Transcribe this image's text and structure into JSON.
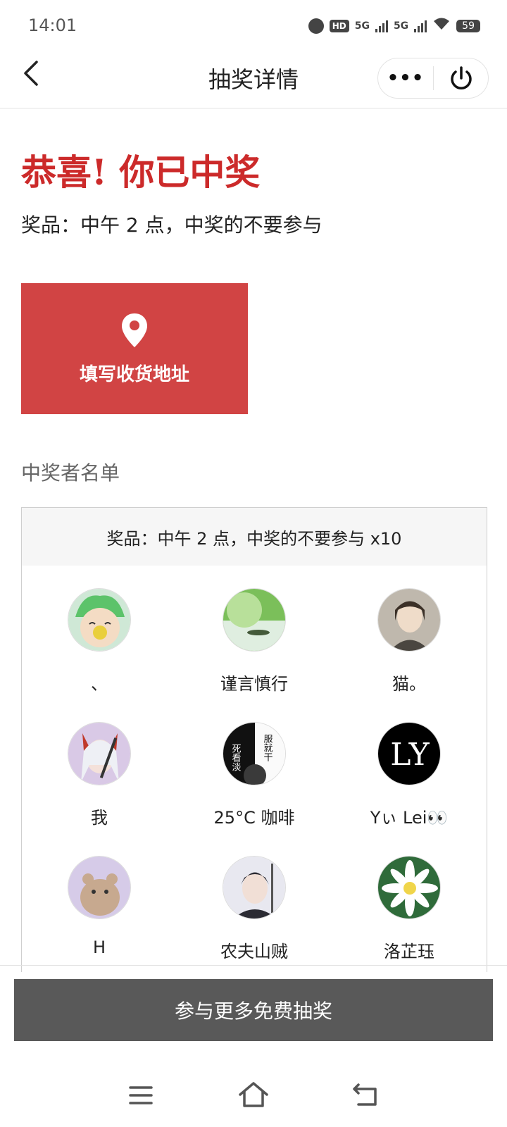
{
  "status": {
    "time": "14:01",
    "hd_badge": "HD",
    "net1": "5G",
    "net2": "5G",
    "battery": "59"
  },
  "nav": {
    "title": "抽奖详情",
    "more_label": "•••"
  },
  "result": {
    "congrats": "恭喜! 你已中奖",
    "prize_line": "奖品：中午 2 点，中奖的不要参与"
  },
  "address_button": {
    "label": "填写收货地址",
    "icon": "location-pin-icon"
  },
  "winners": {
    "title": "中奖者名单",
    "header": "奖品：中午 2 点，中奖的不要参与 x10",
    "list": [
      {
        "name": "、"
      },
      {
        "name": "谨言慎行"
      },
      {
        "name": "猫。"
      },
      {
        "name": "我"
      },
      {
        "name": "25°C 咖啡"
      },
      {
        "name": "Yぃ Lei👀"
      },
      {
        "name": "H"
      },
      {
        "name": "农夫山贼"
      },
      {
        "name": "洛芷珏"
      }
    ]
  },
  "avatar_monograms": {
    "coffee_left": "死看淡",
    "coffee_right": "服就干",
    "ly": "LY"
  },
  "footer": {
    "join_label": "参与更多免费抽奖"
  },
  "colors": {
    "accent_red": "#d14444",
    "congrats_red": "#cc2a2a",
    "join_button": "#595959"
  }
}
